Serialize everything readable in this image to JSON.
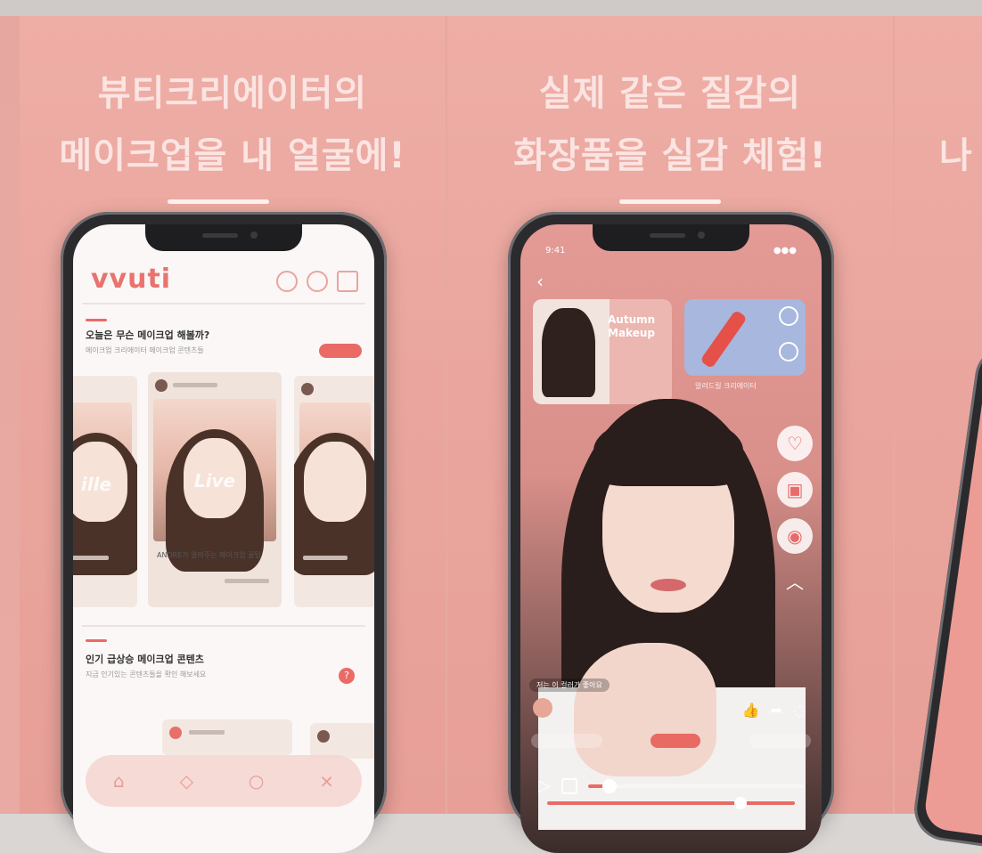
{
  "panels": [
    {
      "headline_line1": "뷰티크리에이터의",
      "headline_line2": "메이크업을 내 얼굴에!"
    },
    {
      "headline_line1": "실제 같은 질감의",
      "headline_line2": "화장품을 실감 체험!"
    },
    {
      "headline_partial": "나"
    }
  ],
  "phone1": {
    "app_logo": "vvuti",
    "header_icons": [
      "notification-icon",
      "search-icon",
      "bag-icon"
    ],
    "section1": {
      "title": "오늘은 무슨 메이크업 해볼까?",
      "subtitle": "메이크업 크리에이터 메이크업 콘텐츠들"
    },
    "cards": [
      {
        "author": "",
        "overlay": "ille",
        "caption": ""
      },
      {
        "author": "",
        "overlay": "Live",
        "caption": "ANDRE가 알려주는 메이크업 꿀팁"
      },
      {
        "author": "",
        "overlay": "",
        "caption": ""
      }
    ],
    "section2": {
      "title": "인기 급상승 메이크업 콘텐츠",
      "subtitle": "지금 인기있는 콘텐츠들을 확인 해보세요"
    },
    "tabbar": [
      "home-icon",
      "shop-icon",
      "chat-icon",
      "profile-icon"
    ]
  },
  "phone2": {
    "status_time": "9:41",
    "status_right": "●●●",
    "thumb1_text": "Autumn Makeup",
    "thumb2_caption": "알려드릴 크리에이터",
    "comment": "저는 이 컬러가 좋아요",
    "side_actions": [
      "heart-icon",
      "palette-icon",
      "product-icon",
      "chevron-up-icon"
    ],
    "progress_fraction": 0.1,
    "timeline_fraction": 0.78,
    "accent": "#ea6a66"
  },
  "colors": {
    "panel": "#eaa79f",
    "headline": "#fbe4e1"
  }
}
